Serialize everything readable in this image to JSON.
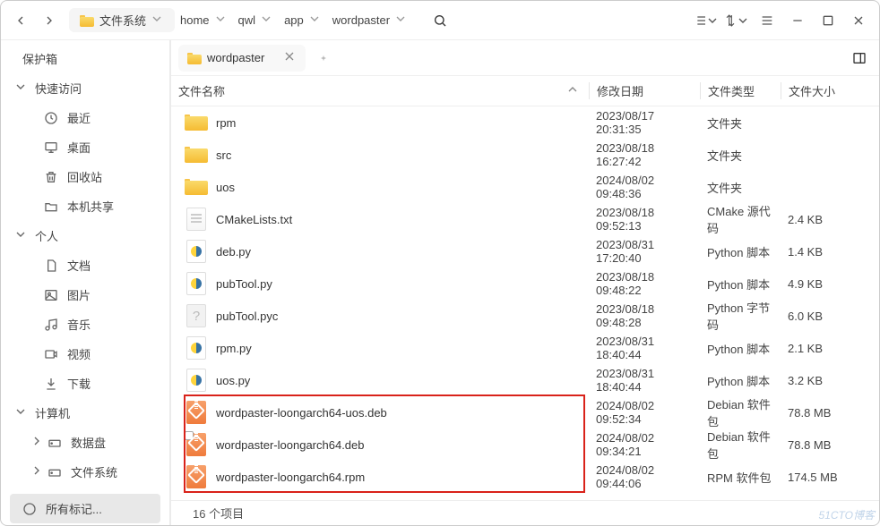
{
  "breadcrumbs": {
    "root_label": "文件系统",
    "items": [
      "home",
      "qwl",
      "app",
      "wordpaster"
    ]
  },
  "sidebar": {
    "protect": "保护箱",
    "quick": "快速访问",
    "quick_items": [
      {
        "label": "最近",
        "icon": "clock-icon"
      },
      {
        "label": "桌面",
        "icon": "desktop-icon"
      },
      {
        "label": "回收站",
        "icon": "trash-icon"
      },
      {
        "label": "本机共享",
        "icon": "folder-icon"
      }
    ],
    "personal": "个人",
    "personal_items": [
      {
        "label": "文档",
        "icon": "doc-icon"
      },
      {
        "label": "图片",
        "icon": "image-icon"
      },
      {
        "label": "音乐",
        "icon": "music-icon"
      },
      {
        "label": "视频",
        "icon": "video-icon"
      },
      {
        "label": "下载",
        "icon": "download-icon"
      }
    ],
    "computer": "计算机",
    "computer_items": [
      {
        "label": "数据盘",
        "icon": "disk-icon"
      },
      {
        "label": "文件系统",
        "icon": "disk-icon"
      }
    ],
    "all_tags": "所有标记..."
  },
  "tab": {
    "label": "wordpaster"
  },
  "columns": {
    "name": "文件名称",
    "date": "修改日期",
    "type": "文件类型",
    "size": "文件大小"
  },
  "files": [
    {
      "name": "rpm",
      "date": "2023/08/17 20:31:35",
      "type": "文件夹",
      "size": "",
      "icon": "folder"
    },
    {
      "name": "src",
      "date": "2023/08/18 16:27:42",
      "type": "文件夹",
      "size": "",
      "icon": "folder"
    },
    {
      "name": "uos",
      "date": "2024/08/02 09:48:36",
      "type": "文件夹",
      "size": "",
      "icon": "folder"
    },
    {
      "name": "CMakeLists.txt",
      "date": "2023/08/18 09:52:13",
      "type": "CMake 源代码",
      "size": "2.4 KB",
      "icon": "text"
    },
    {
      "name": "deb.py",
      "date": "2023/08/31 17:20:40",
      "type": "Python 脚本",
      "size": "1.4 KB",
      "icon": "py"
    },
    {
      "name": "pubTool.py",
      "date": "2023/08/18 09:48:22",
      "type": "Python 脚本",
      "size": "4.9 KB",
      "icon": "py"
    },
    {
      "name": "pubTool.pyc",
      "date": "2023/08/18 09:48:28",
      "type": "Python 字节码",
      "size": "6.0 KB",
      "icon": "unknown"
    },
    {
      "name": "rpm.py",
      "date": "2023/08/31 18:40:44",
      "type": "Python 脚本",
      "size": "2.1 KB",
      "icon": "py"
    },
    {
      "name": "uos.py",
      "date": "2023/08/31 18:40:44",
      "type": "Python 脚本",
      "size": "3.2 KB",
      "icon": "py"
    },
    {
      "name": "wordpaster-loongarch64-uos.deb",
      "date": "2024/08/02 09:52:34",
      "type": "Debian 软件包",
      "size": "78.8 MB",
      "icon": "pkg"
    },
    {
      "name": "wordpaster-loongarch64.deb",
      "date": "2024/08/02 09:34:21",
      "type": "Debian 软件包",
      "size": "78.8 MB",
      "icon": "pkg-lock"
    },
    {
      "name": "wordpaster-loongarch64.rpm",
      "date": "2024/08/02 09:44:06",
      "type": "RPM 软件包",
      "size": "174.5 MB",
      "icon": "pkg"
    }
  ],
  "status": "16 个项目",
  "watermark": "51CTO博客"
}
